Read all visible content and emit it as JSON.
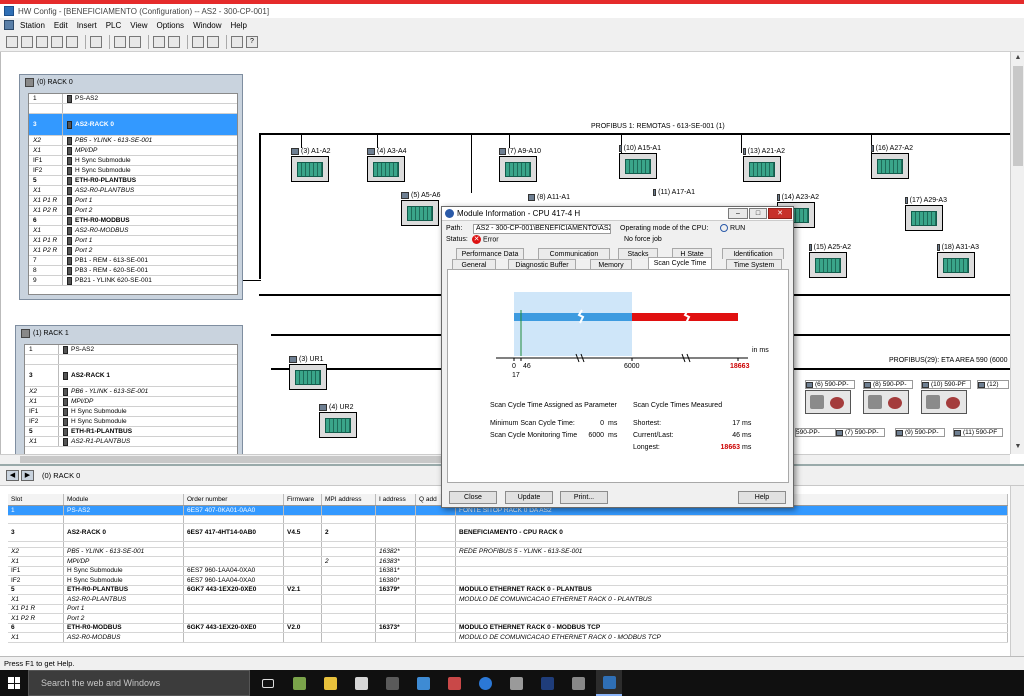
{
  "window": {
    "title": "HW Config - [BENEFICIAMENTO (Configuration) -- AS2 - 300-CP-001]",
    "menu": [
      "Station",
      "Edit",
      "Insert",
      "PLC",
      "View",
      "Options",
      "Window",
      "Help"
    ]
  },
  "rack0": {
    "title": "(0) RACK 0",
    "rows": [
      {
        "slot": "1",
        "module": "PS-AS2"
      },
      {
        "slot": "3",
        "module": "AS2-RACK 0"
      },
      {
        "slot": "X2",
        "module": "PB5 - YLINK - 613-SE-001"
      },
      {
        "slot": "X1",
        "module": "MPI/DP"
      },
      {
        "slot": "IF1",
        "module": "H Sync Submodule"
      },
      {
        "slot": "IF2",
        "module": "H Sync Submodule"
      },
      {
        "slot": "5",
        "module": "ETH-R0-PLANTBUS"
      },
      {
        "slot": "X1",
        "module": "AS2-R0-PLANTBUS"
      },
      {
        "slot": "X1 P1 R",
        "module": "Port 1"
      },
      {
        "slot": "X1 P2 R",
        "module": "Port 2"
      },
      {
        "slot": "6",
        "module": "ETH-R0-MODBUS"
      },
      {
        "slot": "X1",
        "module": "AS2-R0-MODBUS"
      },
      {
        "slot": "X1 P1 R",
        "module": "Port 1"
      },
      {
        "slot": "X1 P2 R",
        "module": "Port 2"
      },
      {
        "slot": "7",
        "module": "PB1 - REM - 613-SE-001"
      },
      {
        "slot": "8",
        "module": "PB3 - REM - 620-SE-001"
      },
      {
        "slot": "9",
        "module": "PB21 - YLINK 620-SE-001"
      }
    ]
  },
  "rack1": {
    "title": "(1) RACK 1",
    "rows": [
      {
        "slot": "1",
        "module": "PS-AS2"
      },
      {
        "slot": "3",
        "module": "AS2-RACK 1"
      },
      {
        "slot": "X2",
        "module": "PB6 - YLINK - 613-SE-001"
      },
      {
        "slot": "X1",
        "module": "MPI/DP"
      },
      {
        "slot": "IF1",
        "module": "H Sync Submodule"
      },
      {
        "slot": "IF2",
        "module": "H Sync Submodule"
      },
      {
        "slot": "5",
        "module": "ETH-R1-PLANTBUS"
      },
      {
        "slot": "X1",
        "module": "AS2-R1-PLANTBUS"
      }
    ]
  },
  "profibus1": {
    "label": "PROFIBUS 1: REMOTAS - 613-SE-001 (1)",
    "devices": [
      "(3) A1-A2",
      "(4) A3-A4",
      "(5) A5-A6",
      "(7) A9-A10",
      "(8) A11-A1",
      "(10) A15-A1",
      "(11) A17-A1",
      "(13) A21-A2",
      "(14) A23-A2",
      "(15) A25-A2",
      "(16) A27-A2",
      "(17) A29-A3",
      "(18) A31-A3"
    ]
  },
  "profibus29": {
    "label": "PROFIBUS(29): ETA AREA 590 (6000",
    "devices": [
      "(3) UR1",
      "(4) UR2"
    ],
    "pp_devices": [
      "(6) 590-PP-",
      "(8) 590-PP-",
      "(10) 590-PF",
      "(12)",
      "590-PP-",
      "(7) 590-PP-",
      "(9) 590-PP-",
      "(11) 590-PF"
    ]
  },
  "lower": {
    "title": "(0)   RACK 0",
    "columns": [
      "Slot",
      "Module",
      "Order number",
      "Firmware",
      "MPI address",
      "I address",
      "Q add",
      ""
    ],
    "rows": [
      {
        "slot": "1",
        "module": "PS-AS2",
        "order": "6ES7 407-0KA01-0AA0",
        "fw": "",
        "mpi": "",
        "iaddr": "",
        "qaddr": "",
        "comment": "FONTE SITOP RACK 0 DA AS2"
      },
      {
        "slot": "3",
        "module": "AS2-RACK 0",
        "order": "6ES7 417-4HT14-0AB0",
        "fw": "V4.5",
        "mpi": "2",
        "iaddr": "",
        "qaddr": "",
        "comment": "BENEFICIAMENTO - CPU RACK 0"
      },
      {
        "slot": "X2",
        "module": "PB5 - YLINK - 613-SE-001",
        "order": "",
        "fw": "",
        "mpi": "",
        "iaddr": "16382*",
        "qaddr": "",
        "comment": "REDE PROFIBUS 5 - YLINK - 613-SE-001"
      },
      {
        "slot": "X1",
        "module": "MPI/DP",
        "order": "",
        "fw": "",
        "mpi": "2",
        "iaddr": "16383*",
        "qaddr": "",
        "comment": ""
      },
      {
        "slot": "IF1",
        "module": "H Sync Submodule",
        "order": "6ES7 960-1AA04-0XA0",
        "fw": "",
        "mpi": "",
        "iaddr": "16381*",
        "qaddr": "",
        "comment": ""
      },
      {
        "slot": "IF2",
        "module": "H Sync Submodule",
        "order": "6ES7 960-1AA04-0XA0",
        "fw": "",
        "mpi": "",
        "iaddr": "16380*",
        "qaddr": "",
        "comment": ""
      },
      {
        "slot": "5",
        "module": "ETH-R0-PLANTBUS",
        "order": "6GK7 443-1EX20-0XE0",
        "fw": "V2.1",
        "mpi": "",
        "iaddr": "16379*",
        "qaddr": "",
        "comment": "MODULO ETHERNET RACK 0 - PLANTBUS"
      },
      {
        "slot": "X1",
        "module": "AS2-R0-PLANTBUS",
        "order": "",
        "fw": "",
        "mpi": "",
        "iaddr": "",
        "qaddr": "",
        "comment": "MODULO DE COMUNICACAO ETHERNET RACK 0 - PLANTBUS"
      },
      {
        "slot": "X1 P1 R",
        "module": "Port 1",
        "order": "",
        "fw": "",
        "mpi": "",
        "iaddr": "",
        "qaddr": "",
        "comment": ""
      },
      {
        "slot": "X1 P2 R",
        "module": "Port 2",
        "order": "",
        "fw": "",
        "mpi": "",
        "iaddr": "",
        "qaddr": "",
        "comment": ""
      },
      {
        "slot": "6",
        "module": "ETH-R0-MODBUS",
        "order": "6GK7 443-1EX20-0XE0",
        "fw": "V2.0",
        "mpi": "",
        "iaddr": "16373*",
        "qaddr": "",
        "comment": "MODULO ETHERNET RACK 0 - MODBUS TCP"
      },
      {
        "slot": "X1",
        "module": "AS2-R0-MODBUS",
        "order": "",
        "fw": "",
        "mpi": "",
        "iaddr": "",
        "qaddr": "",
        "comment": "MODULO DE COMUNICACAO ETHERNET RACK 0 - MODBUS TCP"
      }
    ]
  },
  "status_text": "Press F1 to get Help.",
  "taskbar": {
    "search_placeholder": "Search the web and Windows"
  },
  "dialog": {
    "title": "Module Information - CPU 417-4 H",
    "path_label": "Path:",
    "path_value": "AS2 - 300-CP-001\\BENEFICIAMENTO\\AS2-",
    "status_label": "Status:",
    "status_value": "Error",
    "opmode_label": "Operating mode of the CPU:",
    "opmode_value": "RUN",
    "force_text": "No force job",
    "tabs_row1": [
      "Performance Data",
      "Communication",
      "Stacks",
      "H State",
      "Identification"
    ],
    "tabs_row2": [
      "General",
      "Diagnostic Buffer",
      "Memory",
      "Scan Cycle Time",
      "Time System"
    ],
    "active_tab": "Scan Cycle Time",
    "section_assigned": "Scan Cycle Time Assigned as Parameter",
    "section_measured": "Scan Cycle Times Measured",
    "min_label": "Minimum Scan Cycle Time:",
    "min_value": "0",
    "min_unit": "ms",
    "monitor_label": "Scan Cycle Monitoring Time",
    "monitor_value": "6000",
    "monitor_unit": "ms",
    "shortest_label": "Shortest:",
    "shortest_value": "17",
    "shortest_unit": "ms",
    "current_label": "Current/Last:",
    "current_value": "46",
    "current_unit": "ms",
    "longest_label": "Longest:",
    "longest_value": "18663",
    "longest_unit": "ms",
    "axis_unit": "in ms",
    "axis_labels": {
      "zero": "0",
      "current": "46",
      "monitor": "6000",
      "longest": "18663",
      "shortest": "17"
    },
    "buttons": [
      "Close",
      "Update",
      "Print...",
      "Help"
    ],
    "colors": {
      "blue": "#3d9be0",
      "red": "#e01010",
      "shade": "#cfe6f9",
      "green": "#1f8a3a"
    }
  }
}
